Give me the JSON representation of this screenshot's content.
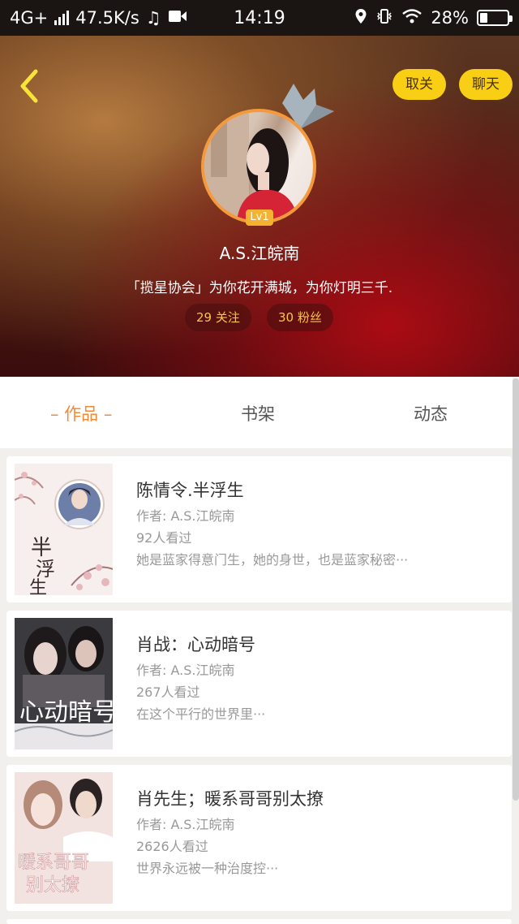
{
  "status_bar": {
    "network": "4G+",
    "speed": "47.5K/s",
    "time": "14:19",
    "battery_percent": "28%",
    "battery_level": 0.28
  },
  "header": {
    "unfollow_label": "取关",
    "chat_label": "聊天",
    "level_badge": "Lv1",
    "username": "A.S.江皖南",
    "bio": "「揽星协会」为你花开满城，为你灯明三千.",
    "following": "29 关注",
    "fans": "30 粉丝"
  },
  "tabs": [
    {
      "label": "– 作品 –",
      "active": true
    },
    {
      "label": "书架",
      "active": false
    },
    {
      "label": "动态",
      "active": false
    }
  ],
  "books": [
    {
      "title": "陈情令.半浮生",
      "author": "作者: A.S.江皖南",
      "views": "92人看过",
      "desc": "她是蓝家得意门生，她的身世，也是蓝家秘密···"
    },
    {
      "title": "肖战：心动暗号",
      "author": "作者: A.S.江皖南",
      "views": "267人看过",
      "desc": "在这个平行的世界里···"
    },
    {
      "title": "肖先生；暖系哥哥别太撩",
      "author": "作者: A.S.江皖南",
      "views": "2626人看过",
      "desc": "世界永远被一种治度控···"
    }
  ],
  "colors": {
    "accent": "#f28a38",
    "button_yellow": "#f8cf14",
    "stat_text": "#f6c64a"
  }
}
